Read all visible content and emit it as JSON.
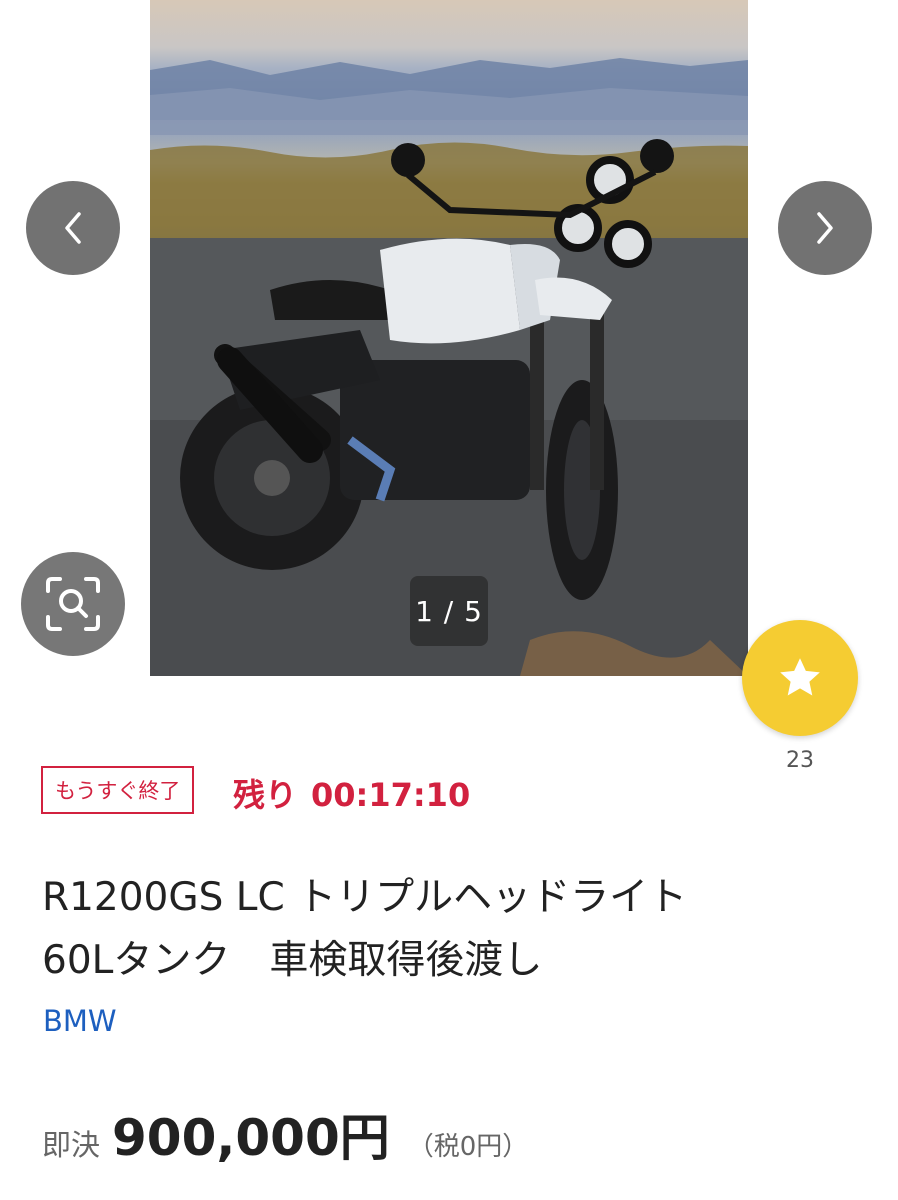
{
  "carousel": {
    "counter": "1 / 5",
    "prev_icon": "chevron-left-icon",
    "next_icon": "chevron-right-icon",
    "lens_icon": "image-search-icon"
  },
  "favorite": {
    "icon": "star-icon",
    "count": "23",
    "color": "#f5cc32"
  },
  "timer": {
    "badge": "もうすぐ終了",
    "remaining_label": "残り",
    "remaining_time": "00:17:10",
    "color": "#d2213f"
  },
  "item": {
    "title_line1": "R1200GS LC トリプルヘッドライト",
    "title_line2": "60Lタンク　車検取得後渡し",
    "brand": "BMW",
    "brand_color": "#1d5fbf"
  },
  "price": {
    "label": "即決",
    "value": "900,000円",
    "tax": "（税0円）"
  }
}
